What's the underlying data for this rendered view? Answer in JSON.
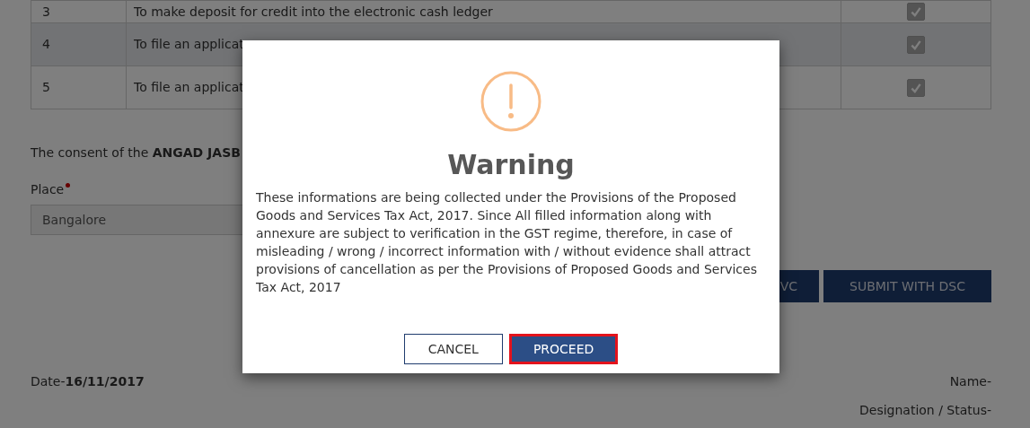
{
  "table": {
    "rows": [
      {
        "number": "3",
        "description": "To make deposit for credit into the electronic cash ledger",
        "checked": true,
        "disabled": true,
        "selected": false
      },
      {
        "number": "4",
        "description": "To file an applicat",
        "checked": true,
        "disabled": true,
        "selected": true
      },
      {
        "number": "5",
        "description": "To file an applicat",
        "checked": true,
        "disabled": true,
        "selected": false
      }
    ]
  },
  "consent": {
    "text": "The consent of the **ANGAD JASB**"
  },
  "place": {
    "label": "Place",
    "required": true,
    "value": "Bangalore"
  },
  "submit_buttons": [
    "VC",
    "SUBMIT WITH DSC"
  ],
  "date": {
    "text": "Date-**16/11/2017**"
  },
  "name_label": "Name-",
  "designation_label": "Designation / Status-",
  "dialog": {
    "title": "Warning",
    "message": "These informations are being collected under the Provisions of the Proposed Goods and Services Tax Act, 2017. Since All filled information along with annexure are subject to verification in the GST regime, therefore, in case of misleading / wrong / incorrect information with / without evidence shall attract provisions of cancellation as per the Provisions of Proposed Goods and Services Tax Act, 2017",
    "buttons": [
      {
        "label": "CANCEL",
        "kind": "secondary"
      },
      {
        "label": "PROCEED",
        "kind": "primary"
      }
    ]
  }
}
